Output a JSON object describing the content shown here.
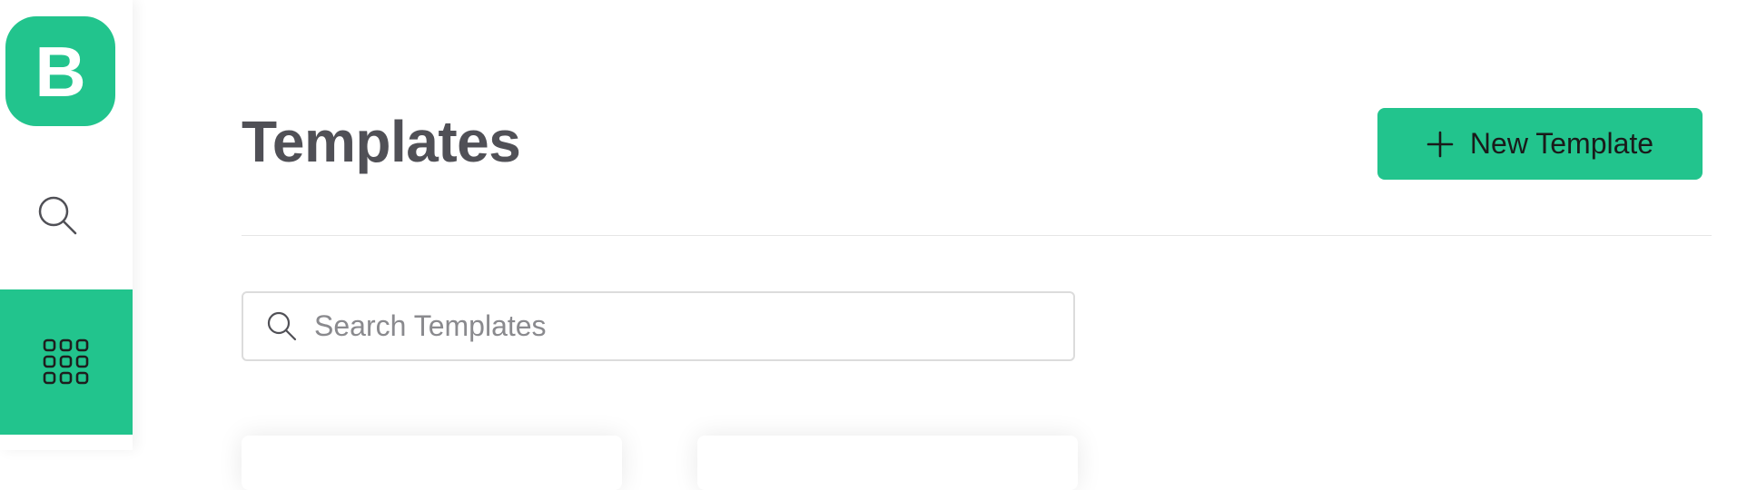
{
  "sidebar": {
    "logo_letter": "B",
    "items": [
      {
        "name": "search",
        "icon": "search-icon"
      },
      {
        "name": "templates",
        "icon": "grid-icon",
        "active": true
      }
    ]
  },
  "header": {
    "title": "Templates",
    "new_button_label": "New Template",
    "new_button_icon": "plus-icon"
  },
  "search": {
    "placeholder": "Search Templates",
    "value": "",
    "icon": "search-icon"
  },
  "cards": [
    {
      "name": "template-card-1"
    },
    {
      "name": "template-card-2"
    }
  ],
  "colors": {
    "accent": "#22c48d",
    "title": "#505056",
    "divider": "#e6e6e6",
    "input_border": "#dcdcdc",
    "placeholder": "#8a8a8e"
  }
}
